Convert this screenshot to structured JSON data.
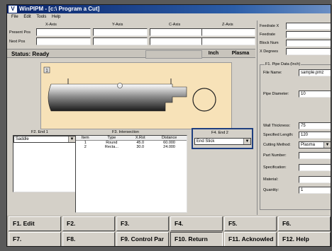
{
  "window": {
    "title": "WinPIPM - [c:\\ Program a Cut]"
  },
  "menu": [
    "File",
    "Edit",
    "Tools",
    "Help"
  ],
  "axes": {
    "x": "X-Axis",
    "y": "Y-Axis",
    "c": "C-Axis",
    "z": "Z-Axis"
  },
  "position": {
    "present_label": "Present Pos",
    "next_label": "Next Pos"
  },
  "status": {
    "text": "Status: Ready",
    "unit": "Inch",
    "mode": "Plasma"
  },
  "right": {
    "top_labels": [
      "Feedrate X",
      "Feedrate",
      "Block Num",
      "X Degrees"
    ],
    "group_title": "F1. Pipe Data (Inch)",
    "file_name_label": "File Name:",
    "file_name_value": "sample.pmz",
    "pipe_diameter_label": "Pipe Diameter:",
    "pipe_diameter_value": "10",
    "wall_thickness_label": "Wall Thickness:",
    "wall_thickness_value": "75",
    "specified_length_label": "Specified Length:",
    "specified_length_value": "120",
    "cutting_method_label": "Cutting Method:",
    "cutting_method_value": "Plasma",
    "part_number_label": "Part Number:",
    "specification_label": "Specification:",
    "material_label": "Material:",
    "quantity_label": "Quantity:",
    "quantity_value": "1"
  },
  "end1": {
    "title": "F2. End 1",
    "value": "Saddle"
  },
  "intersection": {
    "title": "F3. Intersection",
    "headers": [
      "Item",
      "Type",
      "X.Rot",
      "Distance"
    ],
    "rows": [
      [
        "1",
        "Round",
        "45.0",
        "60.000"
      ],
      [
        "2",
        "Recta...",
        "30.0",
        "24.000"
      ]
    ]
  },
  "end2": {
    "title": "F4. End 2",
    "value": "End Stick"
  },
  "canvas": {
    "marker": "1",
    "hole_label": "1"
  },
  "fkeys": [
    "F1. Edit",
    "F2.",
    "F3.",
    "F4.",
    "F5.",
    "F6.",
    "F7.",
    "F8.",
    "F9. Control Par",
    "F10. Return",
    "F11. Acknowled",
    "F12. Help"
  ]
}
